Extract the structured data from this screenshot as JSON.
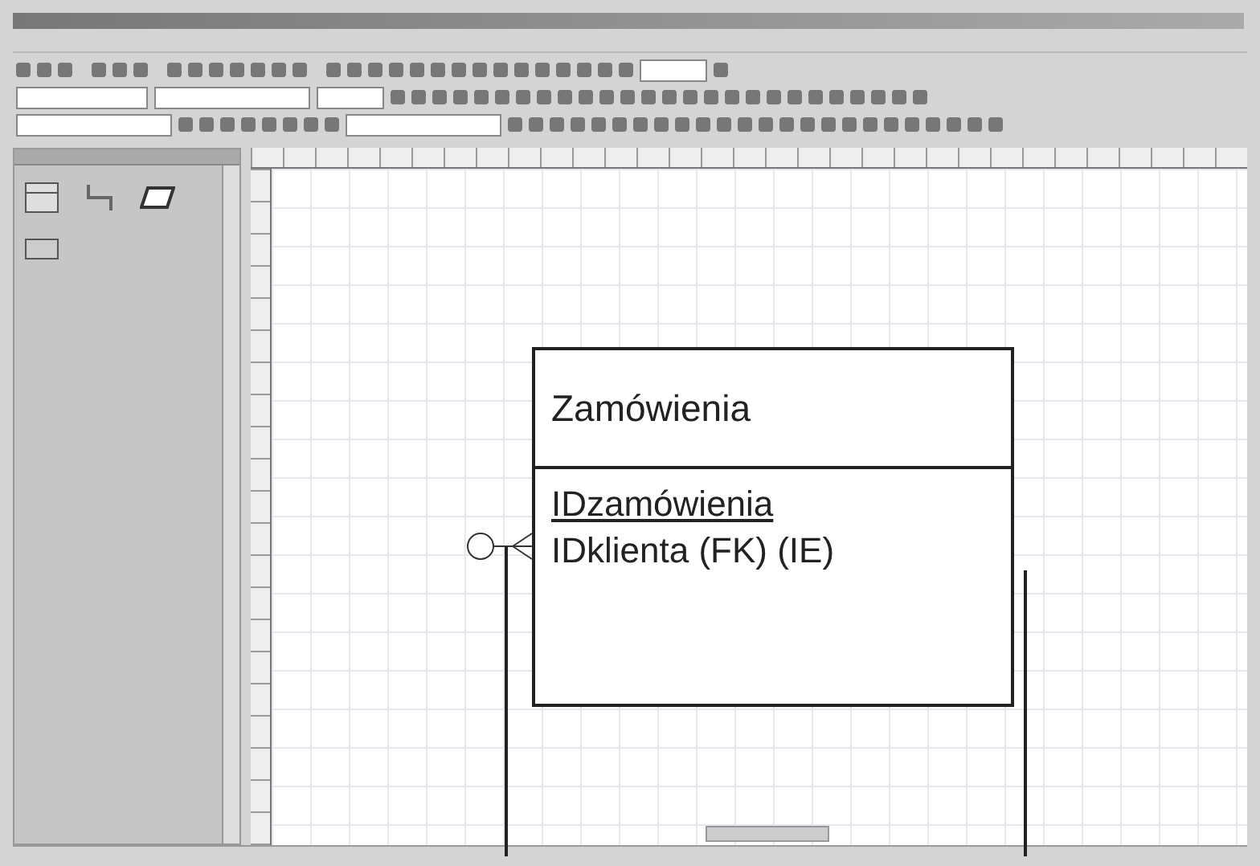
{
  "entity": {
    "title": "Zamówienia",
    "primary_key": "IDzamówienia",
    "attributes": [
      "IDklienta (FK) (IE)"
    ]
  }
}
